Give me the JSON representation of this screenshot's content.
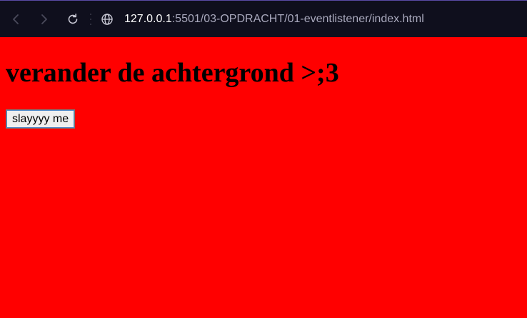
{
  "browser": {
    "url_host": "127.0.0.1",
    "url_path": ":5501/03-OPDRACHT/01-eventlistener/index.html",
    "icons": [
      "back-arrow-icon",
      "forward-arrow-icon",
      "reload-icon",
      "globe-icon"
    ]
  },
  "page": {
    "background_color": "#ff0000",
    "heading": "verander de achtergrond >;3",
    "button_label": "slayyyy me"
  }
}
